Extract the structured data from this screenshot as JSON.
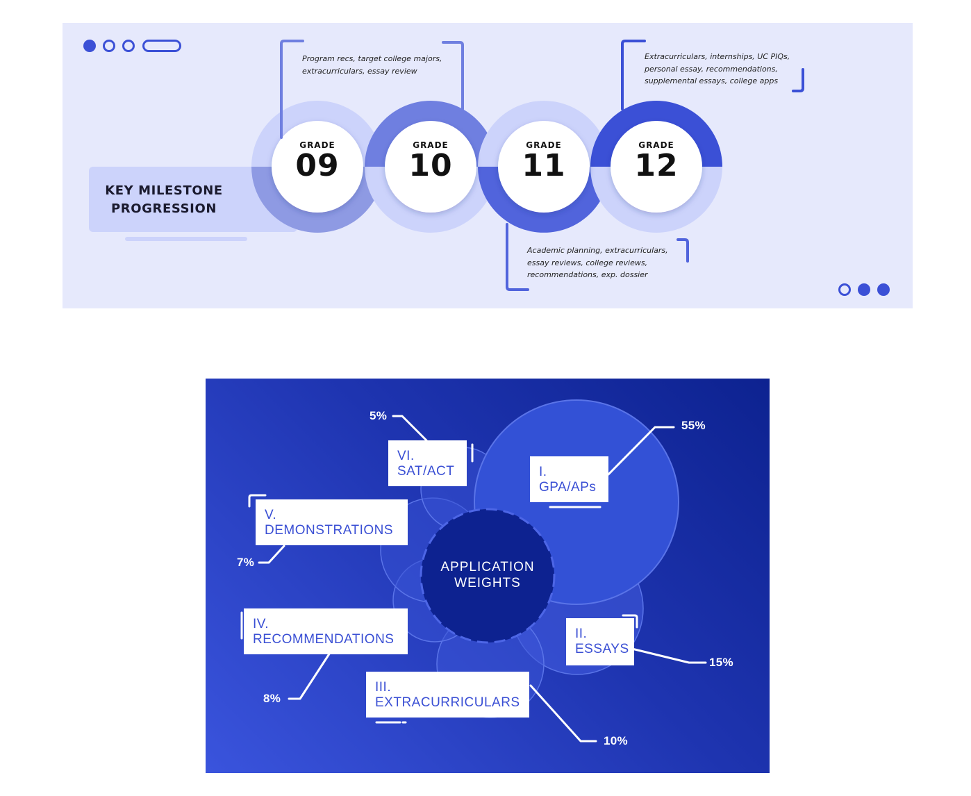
{
  "milestones": {
    "title_line1": "KEY MILESTONE",
    "title_line2": "PROGRESSION",
    "grades": [
      {
        "label": "GRADE",
        "number": "09"
      },
      {
        "label": "GRADE",
        "number": "10"
      },
      {
        "label": "GRADE",
        "number": "11"
      },
      {
        "label": "GRADE",
        "number": "12"
      }
    ],
    "notes": {
      "grade10": [
        "Program recs, target college majors,",
        "extracurriculars, essay review"
      ],
      "grade12": [
        "Extracurriculars, internships, UC PIQs,",
        "personal essay, recommendations,",
        "supplemental essays, college apps"
      ],
      "grade11": [
        "Academic planning, extracurriculars,",
        "essay reviews, college reviews,",
        "recommendations, exp. dossier"
      ]
    }
  },
  "weights": {
    "center_line1": "APPLICATION",
    "center_line2": "WEIGHTS",
    "items": [
      {
        "num": "I.",
        "label": "GPA/APs",
        "pct": "55%"
      },
      {
        "num": "II.",
        "label": "ESSAYS",
        "pct": "15%"
      },
      {
        "num": "III.",
        "label": "EXTRACURRICULARS",
        "pct": "10%"
      },
      {
        "num": "IV.",
        "label": "RECOMMENDATIONS",
        "pct": "8%"
      },
      {
        "num": "V.",
        "label": "DEMONSTRATIONS",
        "pct": "7%"
      },
      {
        "num": "VI.",
        "label": "SAT/ACT",
        "pct": "5%"
      }
    ]
  },
  "colors": {
    "accent": "#3b50d6",
    "panel_light": "#e6e9fc",
    "ring_light": "#ccd3fb",
    "ring_mid": "#6f7fe0",
    "ring_dark": "#3b50d6",
    "bottom_bg": "#1e34b0",
    "center_circle": "#0d2290"
  }
}
